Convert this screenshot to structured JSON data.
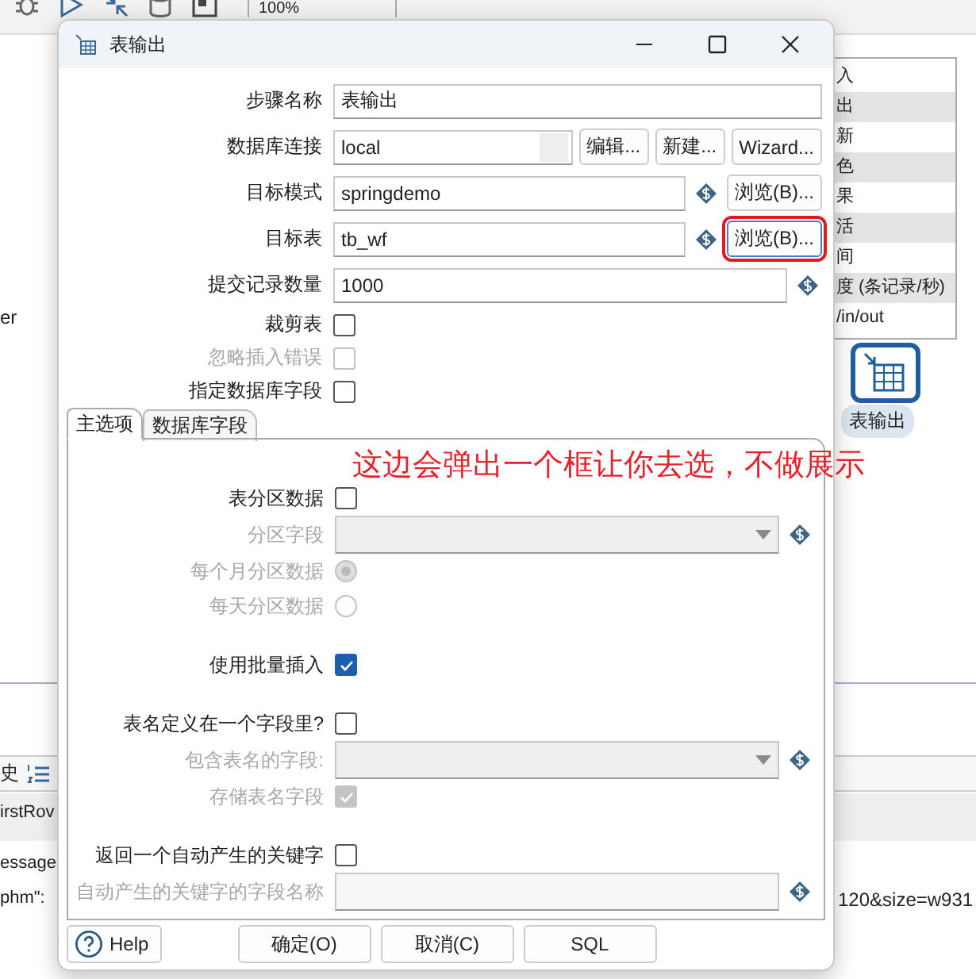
{
  "background": {
    "zoom": "100%",
    "side_rows": [
      "入",
      "出",
      "新",
      "色",
      "果",
      "活",
      "间",
      "度 (条记录/秒)",
      "/in/out"
    ],
    "canvas_text": "er",
    "node_label": "表输出",
    "log_tab": "史",
    "log_lines": [
      "irstRov",
      "essage",
      "phm\":"
    ],
    "log_tail": "120&size=w931"
  },
  "window": {
    "title": "表输出"
  },
  "fields": [
    {
      "kind": "text",
      "label": "步骤名称",
      "value": "表输出"
    },
    {
      "kind": "select",
      "label": "数据库连接",
      "value": "local",
      "buttons": [
        {
          "label": "编辑...",
          "highlighted": false
        },
        {
          "label": "新建...",
          "highlighted": false
        },
        {
          "label": "Wizard...",
          "highlighted": false
        }
      ]
    },
    {
      "kind": "text",
      "label": "目标模式",
      "value": "springdemo",
      "variable": true,
      "buttons": [
        {
          "label": "浏览(B)...",
          "highlighted": false
        }
      ]
    },
    {
      "kind": "text",
      "label": "目标表",
      "value": "tb_wf",
      "variable": true,
      "buttons": [
        {
          "label": "浏览(B)...",
          "highlighted": true
        }
      ]
    },
    {
      "kind": "text",
      "label": "提交记录数量",
      "value": "1000",
      "variable": true
    },
    {
      "kind": "checkbox",
      "label": "裁剪表",
      "checked": false,
      "disabled": false
    },
    {
      "kind": "checkbox",
      "label": "忽略插入错误",
      "checked": false,
      "disabled": true
    },
    {
      "kind": "checkbox",
      "label": "指定数据库字段",
      "checked": false,
      "disabled": false
    }
  ],
  "tabs": [
    {
      "label": "主选项",
      "selected": true
    },
    {
      "label": "数据库字段",
      "selected": false
    }
  ],
  "annotation": "这边会弹出一个框让你去选，不做展示",
  "options": [
    {
      "kind": "checkbox",
      "label": "表分区数据",
      "checked": false,
      "disabled": false
    },
    {
      "kind": "select",
      "label": "分区字段",
      "disabled": true,
      "variable": true
    },
    {
      "kind": "radio",
      "label": "每个月分区数据",
      "checked": true,
      "disabled": true
    },
    {
      "kind": "radio",
      "label": "每天分区数据",
      "checked": false,
      "disabled": true
    },
    {
      "kind": "gap"
    },
    {
      "kind": "checkbox",
      "label": "使用批量插入",
      "checked": true,
      "disabled": false
    },
    {
      "kind": "gap"
    },
    {
      "kind": "checkbox",
      "label": "表名定义在一个字段里?",
      "checked": false,
      "disabled": false
    },
    {
      "kind": "select",
      "label": "包含表名的字段:",
      "disabled": true,
      "variable": true
    },
    {
      "kind": "checkbox",
      "label": "存储表名字段",
      "checked": true,
      "disabled": true
    },
    {
      "kind": "gap"
    },
    {
      "kind": "checkbox",
      "label": "返回一个自动产生的关键字",
      "checked": false,
      "disabled": false
    },
    {
      "kind": "text",
      "label": "自动产生的关键字的字段名称",
      "disabled": true,
      "variable": true
    }
  ],
  "buttons": [
    {
      "kind": "help",
      "label": "Help"
    },
    {
      "kind": "plain",
      "label": "确定(O)"
    },
    {
      "kind": "plain",
      "label": "取消(C)"
    },
    {
      "kind": "plain",
      "label": "SQL"
    }
  ]
}
